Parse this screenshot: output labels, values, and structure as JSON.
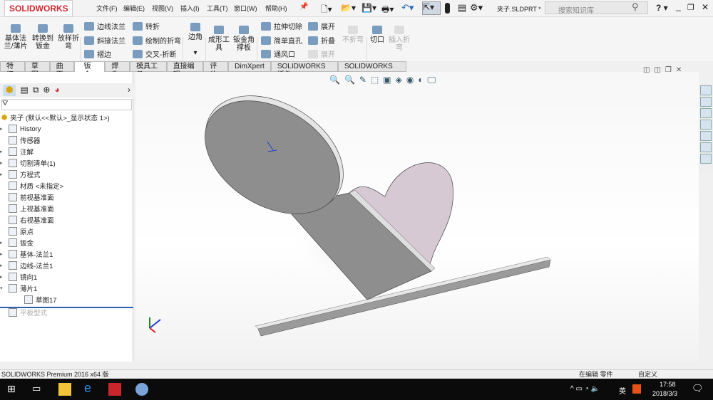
{
  "app": {
    "logo": "SOLIDWORKS",
    "document_title": "夹子.SLDPRT *",
    "search_placeholder": "搜索知识库"
  },
  "menu": [
    "文件(F)",
    "编辑(E)",
    "视图(V)",
    "插入(I)",
    "工具(T)",
    "窗口(W)",
    "帮助(H)"
  ],
  "ribbon": {
    "large": [
      "基体法兰/薄片",
      "转换到钣金",
      "放样折弯",
      "边角",
      "成形工具",
      "钣金角撑板",
      "切口",
      "插入折弯",
      "不折弯"
    ],
    "small": [
      "边线法兰",
      "斜接法兰",
      "褶边",
      "转折",
      "绘制的折弯",
      "交叉-折断",
      "拉伸切除",
      "简单直孔",
      "通风口",
      "展开",
      "折叠",
      "展开"
    ]
  },
  "tabs": [
    "特征",
    "草图",
    "曲面",
    "钣金",
    "焊件",
    "模具工具",
    "直接编辑",
    "评估",
    "DimXpert",
    "SOLIDWORKS 插件",
    "SOLIDWORKS MBD"
  ],
  "active_tab": "钣金",
  "tree": {
    "root": "夹子 (默认<<默认>_显示状态 1>)",
    "items": [
      "History",
      "传感器",
      "注解",
      "切割清单(1)",
      "方程式",
      "材质 <未指定>",
      "前视基准面",
      "上视基准面",
      "右视基准面",
      "原点",
      "钣金",
      "基体-法兰1",
      "边线-法兰1",
      "镜向1",
      "薄片1",
      "草图17",
      "平板型式"
    ]
  },
  "status": {
    "left": "SOLIDWORKS Premium 2016 x64 版",
    "mode": "在编辑 零件",
    "custom": "自定义"
  },
  "taskbar": {
    "time": "17:58",
    "date": "2018/3/3",
    "ime": "英"
  },
  "colors": {
    "accent": "#d1262f",
    "part": "#8e8e8e",
    "heart": "#d6c9d4"
  }
}
